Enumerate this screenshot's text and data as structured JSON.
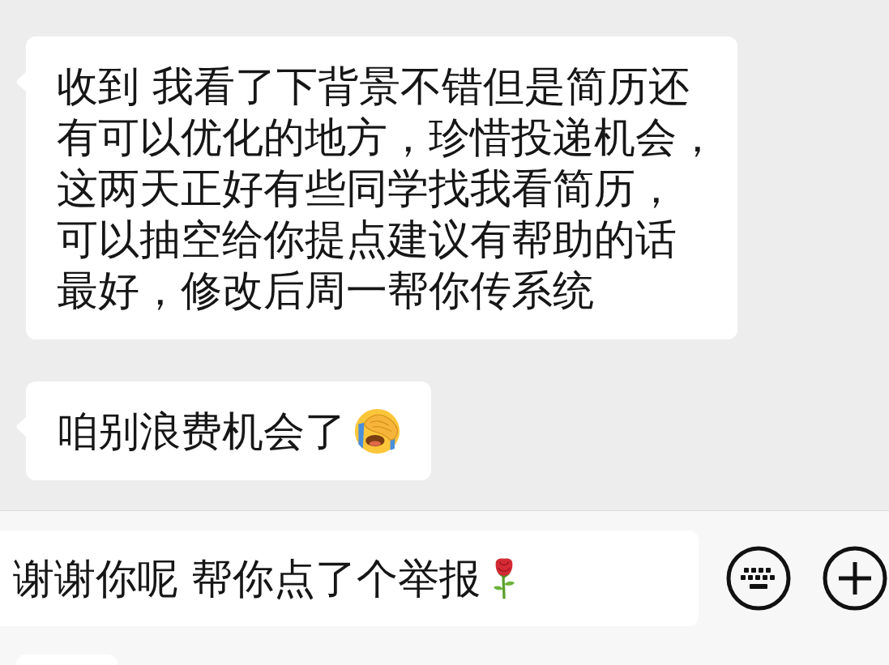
{
  "messages": [
    {
      "lines": [
        "收到 我看了下背景不错但是简历还",
        "有可以优化的地方，珍惜投递机会，",
        "这两天正好有些同学找我看简历，",
        "可以抽空给你提点建议有帮助的话",
        "最好，修改后周一帮你传系统"
      ],
      "has_emoji": false
    },
    {
      "lines": [
        "咱别浪费机会了"
      ],
      "has_emoji": true
    }
  ],
  "input": {
    "value": "谢谢你呢 帮你点了个举报",
    "has_emoji": true
  }
}
